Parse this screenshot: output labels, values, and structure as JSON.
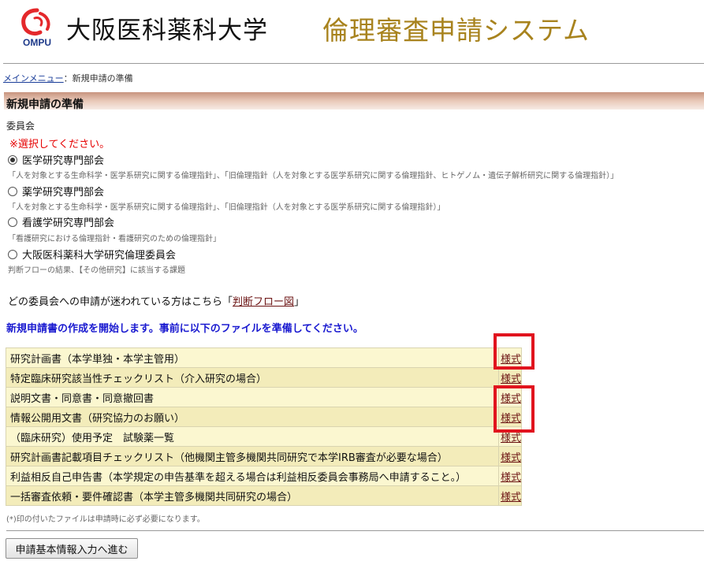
{
  "header": {
    "logo_text": "OMPU",
    "university_name": "大阪医科薬科大学",
    "system_name": "倫理審査申請システム",
    "accent_color": "#a8831e",
    "logo_color": "#e4282b"
  },
  "breadcrumb": {
    "main_menu": "メインメニュー",
    "separator": "：",
    "current": "新規申請の準備"
  },
  "section_title": "新規申請の準備",
  "committee": {
    "label": "委員会",
    "required_note": "※選択してください。",
    "options": [
      {
        "label": "医学研究専門部会",
        "selected": true,
        "desc": "「人を対象とする生命科学・医学系研究に関する倫理指針」、「旧倫理指針（人を対象とする医学系研究に関する倫理指針、ヒトゲノム・遺伝子解析研究に関する倫理指針）」"
      },
      {
        "label": "薬学研究専門部会",
        "selected": false,
        "desc": "「人を対象とする生命科学・医学系研究に関する倫理指針」、「旧倫理指針（人を対象とする医学系研究に関する倫理指針）」"
      },
      {
        "label": "看護学研究専門部会",
        "selected": false,
        "desc": "「看護研究における倫理指針・看護研究のための倫理指針」"
      },
      {
        "label": "大阪医科薬科大学研究倫理委員会",
        "selected": false,
        "desc": "判断フローの結果、【その他研究】に該当する課題"
      }
    ]
  },
  "flow": {
    "prefix": "どの委員会への申請が迷われている方はこちら「",
    "link": "判断フロー図",
    "suffix": "」"
  },
  "instruction": "新規申請書の作成を開始します。事前に以下のファイルを準備してください。",
  "files": {
    "rows": [
      {
        "name": "研究計画書（本学単独・本学主管用）",
        "link": "様式"
      },
      {
        "name": "特定臨床研究該当性チェックリスト（介入研究の場合）",
        "link": "様式"
      },
      {
        "name": "説明文書・同意書・同意撤回書",
        "link": "様式"
      },
      {
        "name": "情報公開用文書（研究協力のお願い）",
        "link": "様式"
      },
      {
        "name": "（臨床研究）使用予定　試験薬一覧",
        "link": "様式"
      },
      {
        "name": "研究計画書記載項目チェックリスト（他機関主管多機関共同研究で本学IRB審査が必要な場合）",
        "link": "様式"
      },
      {
        "name": "利益相反自己申告書（本学規定の申告基準を超える場合は利益相反委員会事務局へ申請すること。）",
        "link": "様式"
      },
      {
        "name": "一括審査依頼・要件確認書（本学主管多機関共同研究の場合）",
        "link": "様式"
      }
    ],
    "footnote": "(*)印の付いたファイルは申請時に必ず必要になります。"
  },
  "next_button": "申請基本情報入力へ進む",
  "highlight_color": "#e1141e"
}
